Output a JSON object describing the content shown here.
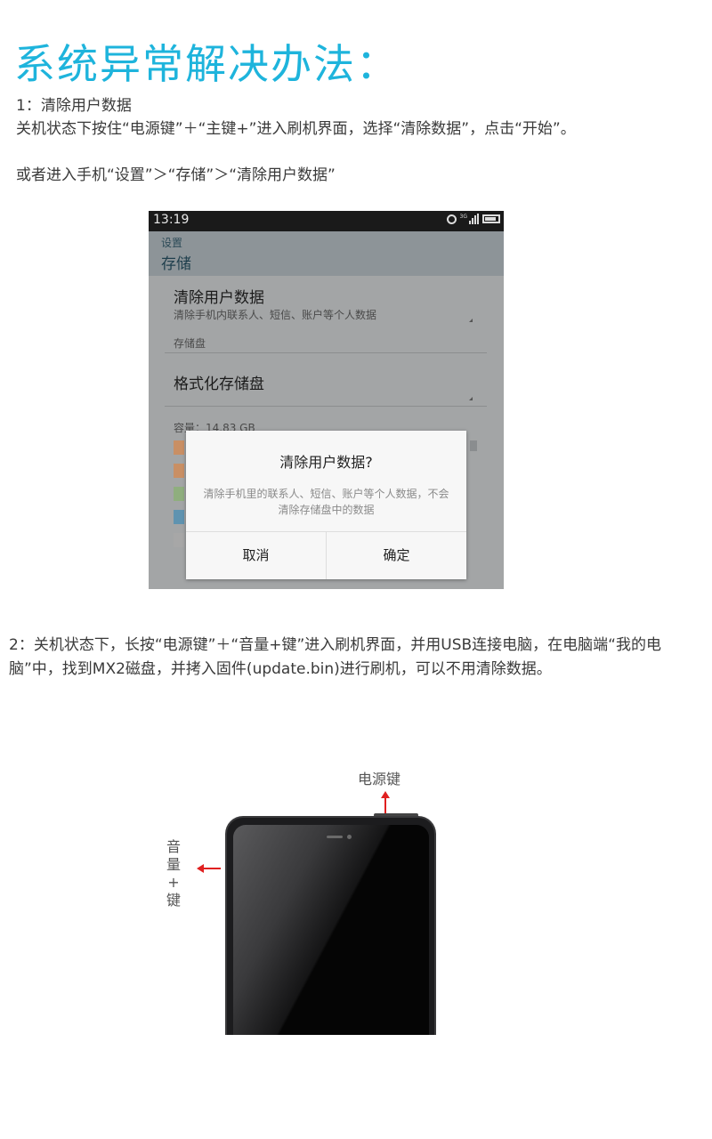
{
  "heading": "系统异常解决办法：",
  "step1": {
    "title": "1：清除用户数据",
    "line1": "关机状态下按住“电源键”＋“主键+”进入刷机界面，选择“清除数据”，点击“开始”。",
    "line2": "或者进入手机“设置”＞“存储”＞“清除用户数据”"
  },
  "phone_screenshot": {
    "status_time": "13:19",
    "status_icons": [
      "alarm-icon",
      "3g-signal-icon",
      "battery-icon"
    ],
    "breadcrumb": "设置",
    "page_title": "存储",
    "clear_data_title": "清除用户数据",
    "clear_data_sub": "清除手机内联系人、短信、账户等个人数据",
    "storage_section": "存储盘",
    "format_title": "格式化存储盘",
    "capacity": "容量：14.83 GB",
    "legend_colors": [
      "#c98f64",
      "#c98f64",
      "#8fae7e",
      "#5f93b0",
      "#a7a7a7"
    ],
    "dialog": {
      "title": "清除用户数据?",
      "message": "清除手机里的联系人、短信、账户等个人数据，不会清除存储盘中的数据",
      "cancel": "取消",
      "confirm": "确定"
    }
  },
  "step2": {
    "text": "2：关机状态下，长按“电源键”＋“音量+键”进入刷机界面，并用USB连接电脑，在电脑端“我的电脑”中，找到MX2磁盘，并拷入固件(update.bin)进行刷机，可以不用清除数据。"
  },
  "diagram": {
    "power_label": "电源键",
    "volume_label": "音量+键",
    "arrow_color": "#e02020"
  },
  "colors": {
    "heading": "#1eb4dc"
  }
}
